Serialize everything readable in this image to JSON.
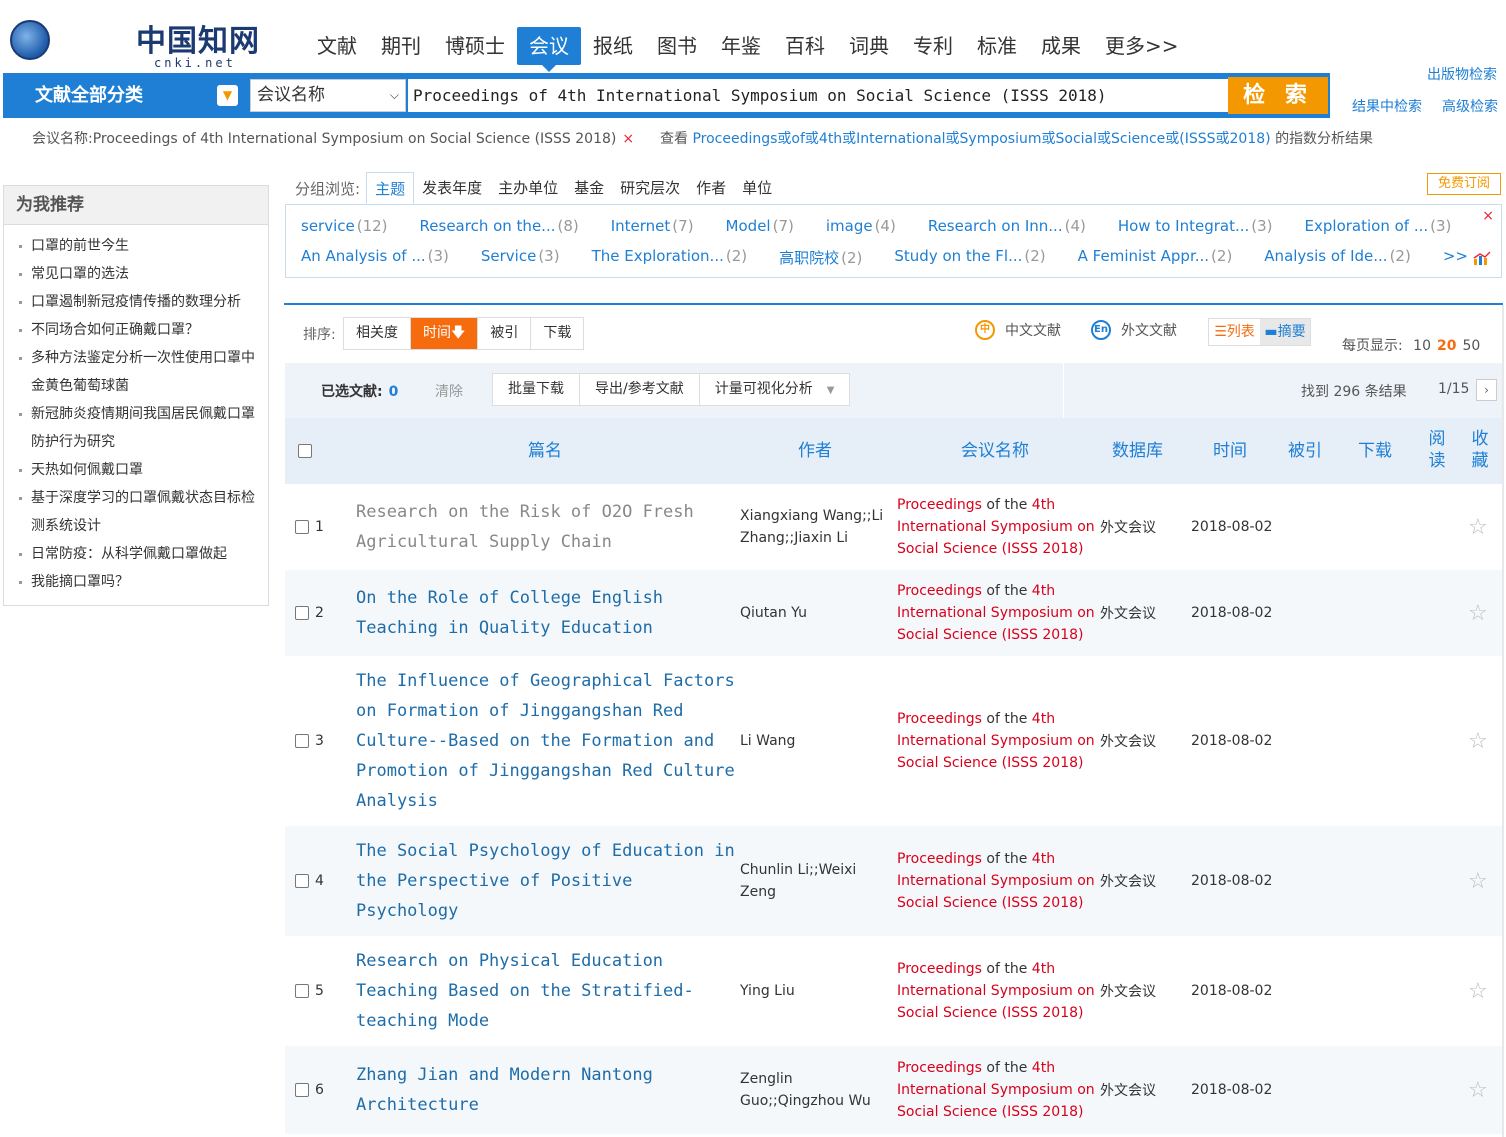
{
  "logo": {
    "mark": "cnki",
    "cn": "中国知网",
    "net": "cnki.net"
  },
  "nav": [
    "文献",
    "期刊",
    "博硕士",
    "会议",
    "报纸",
    "图书",
    "年鉴",
    "百科",
    "词典",
    "专利",
    "标准",
    "成果",
    "更多>>"
  ],
  "nav_active": 3,
  "search": {
    "category_label": "文献全部分类",
    "field": "会议名称",
    "query": "Proceedings of 4th International Symposium on Social Science (ISSS 2018)",
    "button": "检 索"
  },
  "links": {
    "publications": "出版物检索",
    "in_result": "结果中检索",
    "advanced": "高级检索"
  },
  "criteria": {
    "text": "会议名称:Proceedings of 4th International Symposium on Social Science (ISSS 2018)",
    "remove": "×",
    "index_prefix": "查看",
    "index_terms": "Proceedings或of或4th或International或Symposium或Social或Science或(ISSS或2018)",
    "index_suffix": "的指数分析结果"
  },
  "recommend": {
    "title": "为我推荐",
    "items": [
      "口罩的前世今生",
      "常见口罩的选法",
      "口罩遏制新冠疫情传播的数理分析",
      "不同场合如何正确戴口罩？",
      "多种方法鉴定分析一次性使用口罩中金黄色葡萄球菌",
      "新冠肺炎疫情期间我国居民佩戴口罩防护行为研究",
      "天热如何佩戴口罩",
      "基于深度学习的口罩佩戴状态目标检测系统设计",
      "日常防疫：从科学佩戴口罩做起",
      "我能摘口罩吗？"
    ]
  },
  "group": {
    "label": "分组浏览:",
    "tabs": [
      "主题",
      "发表年度",
      "主办单位",
      "基金",
      "研究层次",
      "作者",
      "单位"
    ],
    "free_subscribe": "免费订阅",
    "close": "×",
    "row1": [
      {
        "t": "service",
        "c": "(12)"
      },
      {
        "t": "Research on the...",
        "c": "(8)"
      },
      {
        "t": "Internet",
        "c": "(7)"
      },
      {
        "t": "Model",
        "c": "(7)"
      },
      {
        "t": "image",
        "c": "(4)"
      },
      {
        "t": "Research on Inn...",
        "c": "(4)"
      },
      {
        "t": "How to Integrat...",
        "c": "(3)"
      },
      {
        "t": "Exploration of ...",
        "c": "(3)"
      }
    ],
    "row2": [
      {
        "t": "An Analysis of ...",
        "c": "(3)"
      },
      {
        "t": "Service",
        "c": "(3)"
      },
      {
        "t": "The Exploration...",
        "c": "(2)"
      },
      {
        "t": "高职院校",
        "c": "(2)"
      },
      {
        "t": "Study on the Fl...",
        "c": "(2)"
      },
      {
        "t": "A Feminist Appr...",
        "c": "(2)"
      },
      {
        "t": "Analysis of Ide...",
        "c": "(2)"
      },
      {
        "t": ">>",
        "c": ""
      }
    ]
  },
  "sort": {
    "label": "排序:",
    "options": [
      "相关度",
      "时间",
      "被引",
      "下载"
    ],
    "active": 1,
    "active_arrow": "🡇"
  },
  "lang": {
    "zh": "中文文献",
    "en": "外文文献",
    "zh_icon": "中",
    "en_icon": "En"
  },
  "view": {
    "list": "☰列表",
    "abstract": "▬摘要"
  },
  "per_page": {
    "label": "每页显示:",
    "options": [
      "10",
      "20",
      "50"
    ],
    "active": 1
  },
  "actions": {
    "selected_label": "已选文献:",
    "selected_count": "0",
    "clear": "清除",
    "buttons": [
      "批量下载",
      "导出/参考文献",
      "计量可视化分析"
    ],
    "found": "找到 296 条结果",
    "pager": "1/15",
    "next": "›"
  },
  "table": {
    "headers": {
      "title": "篇名",
      "author": "作者",
      "conf": "会议名称",
      "db": "数据库",
      "date": "时间",
      "cited": "被引",
      "download": "下载",
      "read": "阅读",
      "fav": "收藏"
    },
    "rows": [
      {
        "idx": "1",
        "title": "Research on the Risk of O2O Fresh Agricultural Supply Chain",
        "author": "Xiangxiang Wang;;Li Zhang;;Jiaxin Li",
        "db": "外文会议",
        "date": "2018-08-02"
      },
      {
        "idx": "2",
        "title": "On the Role of College English Teaching in Quality Education",
        "author": "Qiutan Yu",
        "db": "外文会议",
        "date": "2018-08-02"
      },
      {
        "idx": "3",
        "title": "The Influence of Geographical Factors on Formation of Jinggangshan Red Culture--Based on the Formation and Promotion of Jinggangshan Red Culture Analysis",
        "author": "Li Wang",
        "db": "外文会议",
        "date": "2018-08-02"
      },
      {
        "idx": "4",
        "title": "The Social Psychology of Education in the Perspective of Positive Psychology",
        "author": "Chunlin Li;;Weixi Zeng",
        "db": "外文会议",
        "date": "2018-08-02"
      },
      {
        "idx": "5",
        "title": "Research on Physical Education Teaching Based on the Stratified-teaching Mode",
        "author": "Ying Liu",
        "db": "外文会议",
        "date": "2018-08-02"
      },
      {
        "idx": "6",
        "title": "Zhang Jian and Modern Nantong Architecture",
        "author": "Zenglin Guo;;Qingzhou Wu",
        "db": "外文会议",
        "date": "2018-08-02"
      }
    ],
    "conf_parts": [
      "Proceedings",
      " of the ",
      "4th International Symposium on Social Science (ISSS 2018)"
    ],
    "star": "☆"
  }
}
